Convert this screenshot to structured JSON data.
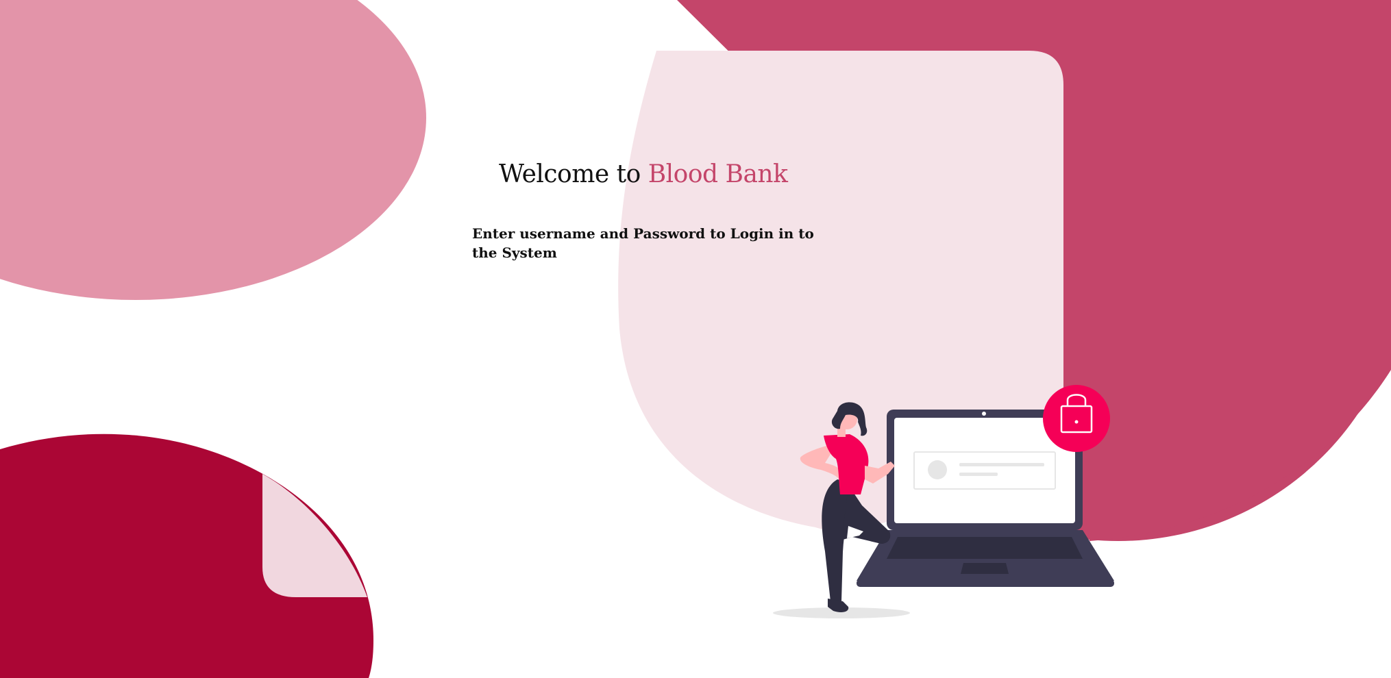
{
  "page": {
    "welcome_prefix": "Welcome to",
    "brand_name": "Blood Bank",
    "instructions": "Enter username and Password to Login in to the System"
  },
  "colors": {
    "brand": "#c4456a",
    "pink_blob": "#e394a9",
    "dark_red": "#ab0635",
    "card_tint": "#f5e3e8",
    "lock_badge": "#f50057",
    "laptop": "#3f3d56"
  },
  "illustration": {
    "icon": "lock-icon",
    "subject": "person-with-laptop-illustration"
  }
}
